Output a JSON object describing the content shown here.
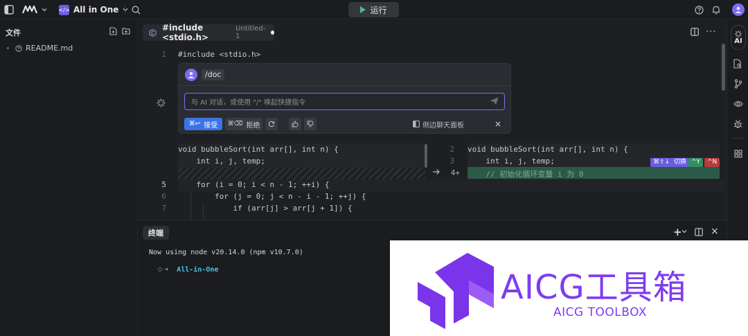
{
  "topbar": {
    "project_name": "All in One",
    "run_label": "运行"
  },
  "sidebar": {
    "title": "文件",
    "files": [
      "README.md"
    ]
  },
  "rail": {
    "ai_label": "AI"
  },
  "editor": {
    "tab": {
      "name": "#include <stdio.h>",
      "subtitle": "Untitled-1"
    },
    "line1": {
      "num": "1",
      "code": "#include <stdio.h>"
    },
    "ai_panel": {
      "command": "/doc",
      "input_placeholder": "与 AI 对话，或使用 \"/\" 唤起快捷指令",
      "accept_shortcut": "⌘↩",
      "accept_label": "接受",
      "reject_shortcut": "⌘⌫",
      "reject_label": "拒绝",
      "side_panel_label": "侧边聊天面板",
      "close": "×"
    },
    "diff_left": [
      "void bubbleSort(int arr[], int n) {",
      "    int i, j, temp;"
    ],
    "diff_right": [
      {
        "num": "2",
        "code": "void bubbleSort(int arr[], int n) {"
      },
      {
        "num": "3",
        "code": "    int i, j, temp;"
      },
      {
        "num": "4+",
        "code": "    // 初始化循环变量 i 为 0"
      }
    ],
    "chips": {
      "switch_keys": "⌘⇧↓",
      "switch_label": "切换",
      "yes": "^Y",
      "no": "^N"
    },
    "lines": [
      {
        "num": "5",
        "code": "    for (i = 0; i < n - 1; ++i) {"
      },
      {
        "num": "6",
        "code": "        for (j = 0; j < n - i - 1; ++j) {"
      },
      {
        "num": "7",
        "code": "            if (arr[j] > arr[j + 1]) {"
      }
    ]
  },
  "terminal": {
    "tab_label": "终端",
    "line1": "Now using node v20.14.0 (npm v10.7.0)",
    "prompt_arrow": "➜",
    "prompt_dir": "All-in-One",
    "new_label": "+",
    "close": "×"
  },
  "watermark": {
    "title": "AICG工具箱",
    "subtitle": "AICG TOOLBOX"
  }
}
